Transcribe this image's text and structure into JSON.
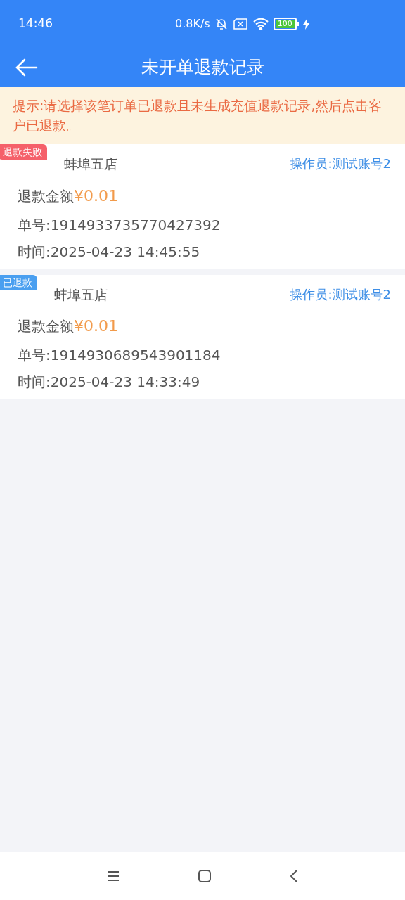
{
  "status_bar": {
    "time": "14:46",
    "speed": "0.8K/s",
    "battery": "100"
  },
  "header": {
    "title": "未开单退款记录"
  },
  "notice": {
    "text": "提示:请选择该笔订单已退款且未生成充值退款记录,然后点击客户已退款。"
  },
  "records": [
    {
      "status": {
        "kind": "failed",
        "label": "退款失败"
      },
      "store": "蚌埠五店",
      "operator": "操作员:测试账号2",
      "amount_label": "退款金额",
      "amount": "¥0.01",
      "order_no": "单号:1914933735770427392",
      "time": "时间:2025-04-23 14:45:55"
    },
    {
      "status": {
        "kind": "refunded",
        "label": "已退款"
      },
      "store": "蚌埠五店",
      "operator": "操作员:测试账号2",
      "amount_label": "退款金额",
      "amount": "¥0.01",
      "order_no": "单号:1914930689543901184",
      "time": "时间:2025-04-23 14:33:49"
    }
  ]
}
